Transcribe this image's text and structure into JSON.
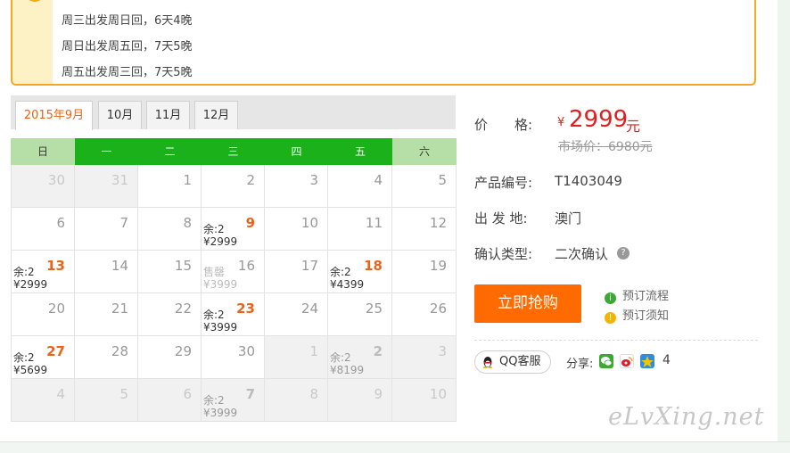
{
  "notice": {
    "lines": [
      "周三出发周日回，6天4晚",
      "周日出发周五回，7天5晚",
      "周五出发周三回，7天5晚"
    ]
  },
  "calendar": {
    "tabs": [
      "2015年9月",
      "10月",
      "11月",
      "12月"
    ],
    "active_tab": "2015年9月",
    "weekdays": [
      "日",
      "一",
      "二",
      "三",
      "四",
      "五",
      "六"
    ],
    "header_colors": {
      "weekend": "#b5dfa6",
      "weekday": "#1ab11a",
      "weekday_text": "#ffffff",
      "weekend_text": "#333333"
    },
    "weeks": [
      [
        {
          "day": "30",
          "state": "other"
        },
        {
          "day": "31",
          "state": "other"
        },
        {
          "day": "1",
          "state": "normal"
        },
        {
          "day": "2",
          "state": "normal"
        },
        {
          "day": "3",
          "state": "normal"
        },
        {
          "day": "4",
          "state": "normal"
        },
        {
          "day": "5",
          "state": "normal"
        }
      ],
      [
        {
          "day": "6",
          "state": "normal"
        },
        {
          "day": "7",
          "state": "normal"
        },
        {
          "day": "8",
          "state": "normal"
        },
        {
          "day": "9",
          "state": "available",
          "stock": "余:2",
          "price": "¥2999"
        },
        {
          "day": "10",
          "state": "normal"
        },
        {
          "day": "11",
          "state": "normal"
        },
        {
          "day": "12",
          "state": "normal"
        }
      ],
      [
        {
          "day": "13",
          "state": "available",
          "stock": "余:2",
          "price": "¥2999"
        },
        {
          "day": "14",
          "state": "normal"
        },
        {
          "day": "15",
          "state": "normal"
        },
        {
          "day": "16",
          "state": "soldout",
          "stock": "售罄",
          "price": "¥3999"
        },
        {
          "day": "17",
          "state": "normal"
        },
        {
          "day": "18",
          "state": "available",
          "stock": "余:2",
          "price": "¥4399"
        },
        {
          "day": "19",
          "state": "normal"
        }
      ],
      [
        {
          "day": "20",
          "state": "normal"
        },
        {
          "day": "21",
          "state": "normal"
        },
        {
          "day": "22",
          "state": "normal"
        },
        {
          "day": "23",
          "state": "available",
          "stock": "余:2",
          "price": "¥3999"
        },
        {
          "day": "24",
          "state": "normal"
        },
        {
          "day": "25",
          "state": "normal"
        },
        {
          "day": "26",
          "state": "normal"
        }
      ],
      [
        {
          "day": "27",
          "state": "available",
          "stock": "余:2",
          "price": "¥5699"
        },
        {
          "day": "28",
          "state": "normal"
        },
        {
          "day": "29",
          "state": "normal"
        },
        {
          "day": "30",
          "state": "normal"
        },
        {
          "day": "1",
          "state": "other"
        },
        {
          "day": "2",
          "state": "other-avail",
          "stock": "余:2",
          "price": "¥8199"
        },
        {
          "day": "3",
          "state": "other"
        }
      ],
      [
        {
          "day": "4",
          "state": "other"
        },
        {
          "day": "5",
          "state": "other"
        },
        {
          "day": "6",
          "state": "other"
        },
        {
          "day": "7",
          "state": "other-avail",
          "stock": "余:2",
          "price": "¥3999"
        },
        {
          "day": "8",
          "state": "other"
        },
        {
          "day": "9",
          "state": "other"
        },
        {
          "day": "10",
          "state": "other"
        }
      ]
    ]
  },
  "product": {
    "price_label": "价　　格:",
    "price_currency": "¥",
    "price_value": "2999",
    "price_unit": "元",
    "market_price": "市场价：6980元",
    "code_label": "产品编号:",
    "code_value": "T1403049",
    "departure_label": "出 发 地:",
    "departure_value": "澳门",
    "confirm_label": "确认类型:",
    "confirm_value": "二次确认",
    "confirm_help": "?"
  },
  "actions": {
    "buy_label": "立即抢购",
    "process_label": "预订流程",
    "notes_label": "预订须知"
  },
  "share": {
    "qq_label": "QQ客服",
    "share_label": "分享:",
    "count": "4",
    "icons": [
      "wechat-icon",
      "weibo-icon",
      "qzone-icon"
    ]
  },
  "watermark": "eLvXing.net",
  "colors": {
    "accent": "#ff6b00",
    "price": "#e02020",
    "available_day": "#e8641a",
    "notice_border": "#f5a623"
  }
}
